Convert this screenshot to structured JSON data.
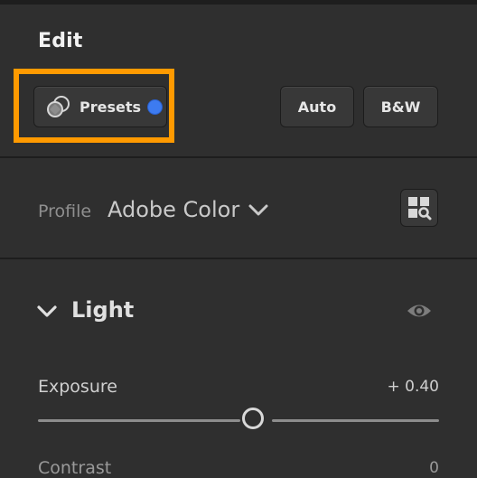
{
  "panel": {
    "title": "Edit"
  },
  "buttons": {
    "presets_label": "Presets",
    "auto_label": "Auto",
    "bw_label": "B&W"
  },
  "profile": {
    "label": "Profile",
    "value": "Adobe Color"
  },
  "light_section": {
    "title": "Light",
    "expanded": true
  },
  "sliders": {
    "exposure": {
      "label": "Exposure",
      "value_text": "+ 0.40",
      "value": 0.4,
      "min": -5,
      "max": 5
    },
    "contrast": {
      "label": "Contrast",
      "value_text": "0"
    }
  },
  "icons": {
    "presets": "presets-icon",
    "presets_indicator": "blue-dot",
    "profile_dropdown": "chevron-down-icon",
    "profile_browser": "grid-search-icon",
    "light_toggle": "chevron-down-icon",
    "visibility": "eye-icon"
  },
  "colors": {
    "background": "#2f2f2f",
    "highlight": "#ff9a00",
    "indicator": "#3d7bf0"
  }
}
